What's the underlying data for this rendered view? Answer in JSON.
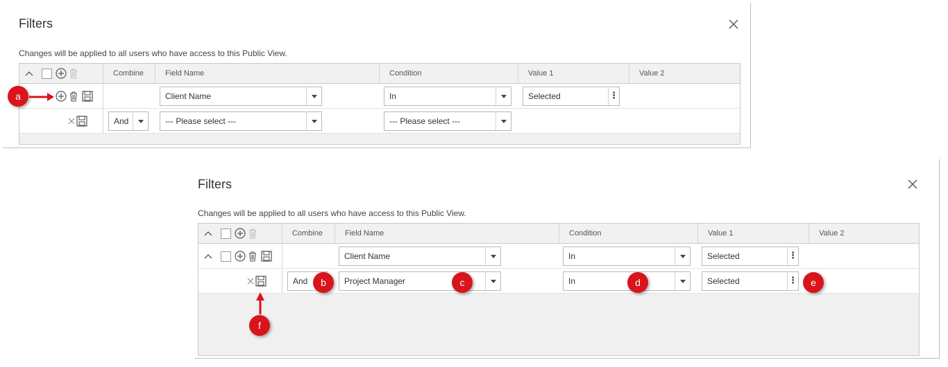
{
  "dialog1": {
    "title": "Filters",
    "notice": "Changes will be applied to all users who have access to this Public View.",
    "columns": {
      "combine": "Combine",
      "field_name": "Field Name",
      "condition": "Condition",
      "value1": "Value 1",
      "value2": "Value 2"
    },
    "rows": [
      {
        "field": "Client Name",
        "condition": "In",
        "value1": "Selected"
      },
      {
        "combine": "And",
        "field": "--- Please select ---",
        "condition": "--- Please select ---"
      }
    ],
    "callout": "a"
  },
  "dialog2": {
    "title": "Filters",
    "notice": "Changes will be applied to all users who have access to this Public View.",
    "columns": {
      "combine": "Combine",
      "field_name": "Field Name",
      "condition": "Condition",
      "value1": "Value 1",
      "value2": "Value 2"
    },
    "rows": [
      {
        "field": "Client Name",
        "condition": "In",
        "value1": "Selected"
      },
      {
        "combine": "And",
        "field": "Project Manager",
        "condition": "In",
        "value1": "Selected"
      }
    ],
    "callouts": [
      "b",
      "c",
      "d",
      "e",
      "f"
    ]
  },
  "colors": {
    "callout": "#d9141b",
    "header_bg": "#f1f1f1",
    "border": "#c9c9c9"
  },
  "icons": [
    "collapse-icon",
    "checkbox-icon",
    "add-icon",
    "trash-icon",
    "save-icon",
    "remove-icon",
    "close-icon",
    "dropdown-arrow-icon",
    "more-options-icon",
    "arrow-icon"
  ]
}
